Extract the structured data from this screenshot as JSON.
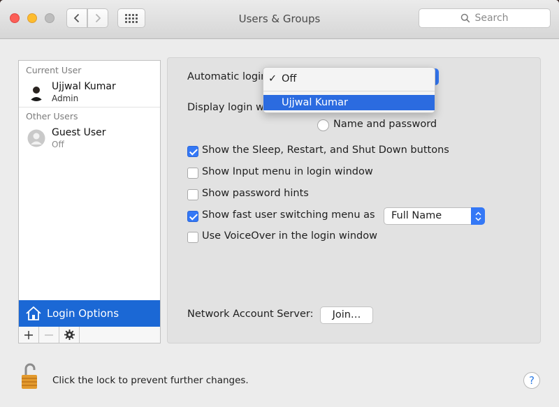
{
  "window": {
    "title": "Users & Groups"
  },
  "toolbar": {
    "search_placeholder": "Search"
  },
  "sidebar": {
    "current_user_header": "Current User",
    "other_users_header": "Other Users",
    "users": [
      {
        "name": "Ujjwal Kumar",
        "role": "Admin"
      },
      {
        "name": "Guest User",
        "role": "Off"
      }
    ],
    "login_options_label": "Login Options"
  },
  "login": {
    "automatic_login_label": "Automatic login",
    "display_login_label": "Display login wi",
    "name_password_label": "Name and password",
    "menu": {
      "off_label": "Off",
      "check": "✓",
      "user_label": "Ujjwal Kumar"
    },
    "options": [
      {
        "label": "Show the Sleep, Restart, and Shut Down buttons",
        "checked": true
      },
      {
        "label": "Show Input menu in login window",
        "checked": false
      },
      {
        "label": "Show password hints",
        "checked": false
      },
      {
        "label": "Show fast user switching menu as",
        "checked": true
      },
      {
        "label": "Use VoiceOver in the login window",
        "checked": false
      }
    ],
    "fast_switch_value": "Full Name",
    "network_account_label": "Network Account Server:",
    "join_label": "Join…"
  },
  "footer": {
    "lock_text": "Click the lock to prevent further changes.",
    "help_label": "?"
  },
  "colors": {
    "accent": "#3478f6",
    "selection": "#1b68d5"
  }
}
